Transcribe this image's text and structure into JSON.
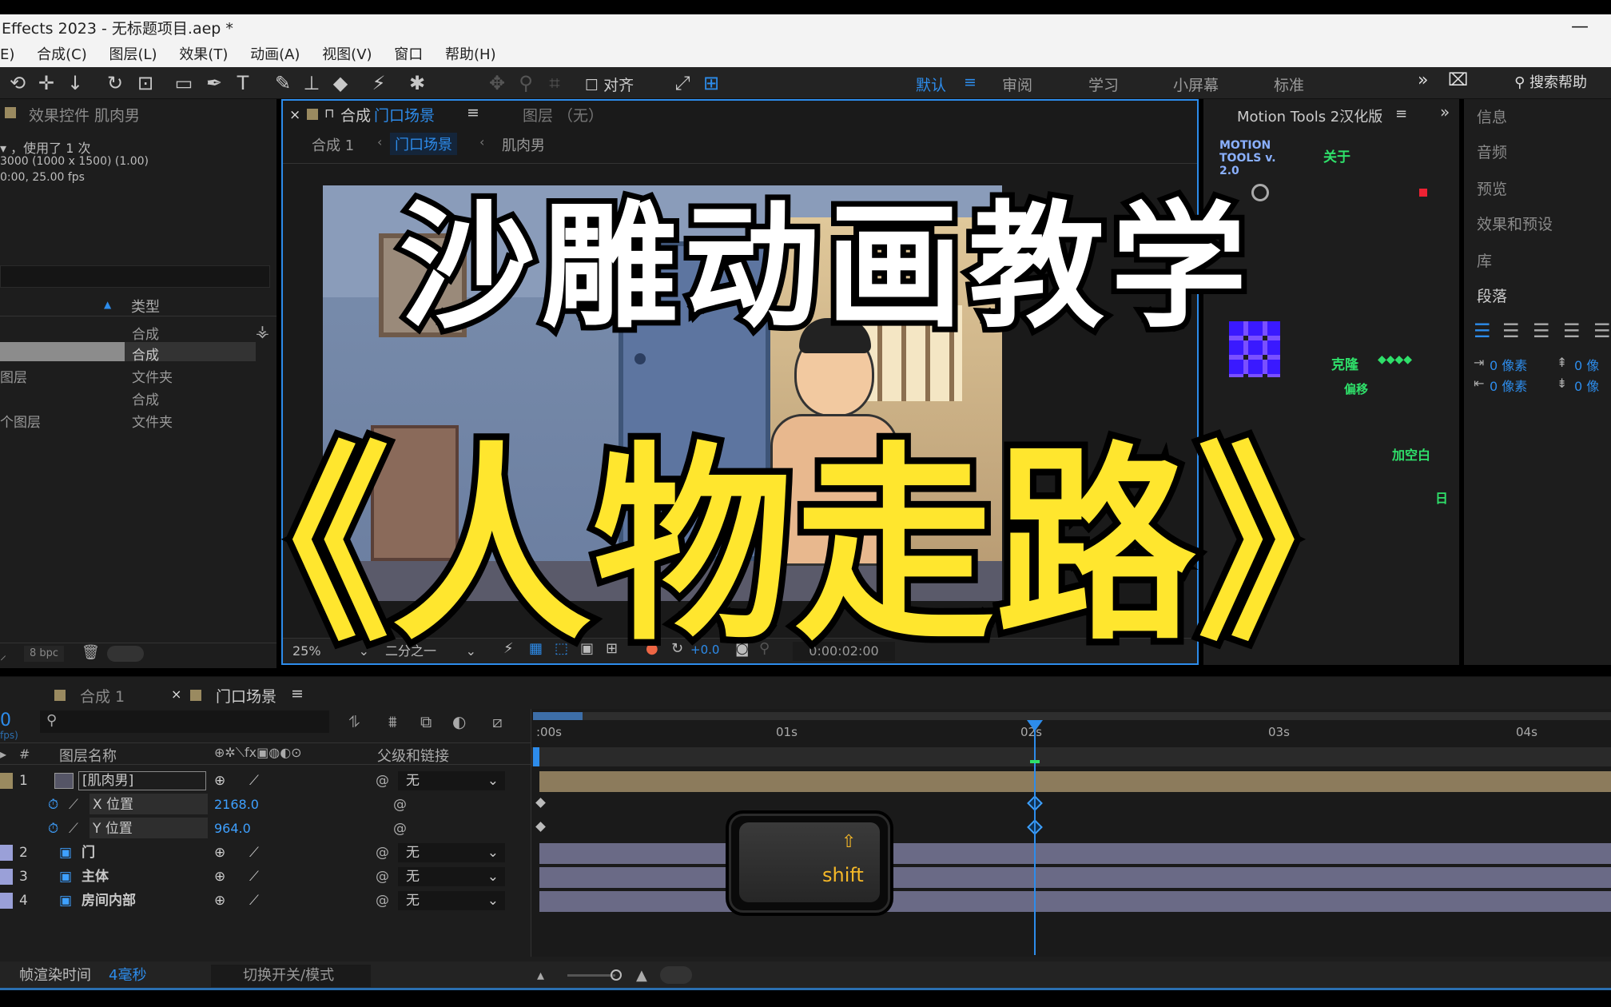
{
  "window": {
    "title": "Effects 2023 - 无标题项目.aep *",
    "minimize": "—"
  },
  "menu": [
    "E)",
    "合成(C)",
    "图层(L)",
    "效果(T)",
    "动画(A)",
    "视图(V)",
    "窗口",
    "帮助(H)"
  ],
  "toolbar": {
    "snap_label": "对齐",
    "workspaces": [
      "默认",
      "审阅",
      "学习",
      "小屏幕",
      "标准"
    ],
    "active_workspace": "默认",
    "more": "»",
    "search_help": "搜索帮助"
  },
  "project_panel": {
    "title": "效果控件 肌肉男",
    "info_line1": "▾ ，使用了 1 次",
    "info_line2": "3000 (1000 x 1500) (1.00)",
    "info_line3": "0:00, 25.00 fps",
    "type_header": "类型",
    "items": [
      {
        "name": "",
        "type": "合成"
      },
      {
        "name": "",
        "type": "合成"
      },
      {
        "name": "图层",
        "type": "文件夹"
      },
      {
        "name": "",
        "type": "合成"
      },
      {
        "name": "个图层",
        "type": "文件夹"
      }
    ],
    "bpc": "8 bpc"
  },
  "viewer": {
    "tab_close": "×",
    "tab_lock": "🔒",
    "tab_prefix": "合成",
    "tab_name": "门口场景",
    "layer_tab": "图层  （无）",
    "breadcrumbs": [
      "合成 1",
      "门口场景",
      "肌肉男"
    ],
    "zoom": "25%",
    "resolution": "二分之一",
    "exposure": "+0.0",
    "timecode": "0:00:02:00"
  },
  "overlay": {
    "title_line1": "沙雕动画教学",
    "title_line2": "《人物走路》"
  },
  "motion_tools": {
    "title": "Motion Tools 2汉化版",
    "logo": "MOTION TOOLS v. 2.0",
    "about": "关于",
    "clone": "克隆",
    "offset": "偏移",
    "add_null": "加空白",
    "ri": "日"
  },
  "right_panels": {
    "items": [
      "信息",
      "音频",
      "预览",
      "效果和预设",
      "库",
      "段落"
    ],
    "indent_values": [
      "0 像素",
      "0 像",
      "0 像素",
      "0 像"
    ]
  },
  "timeline": {
    "tabs": [
      "合成 1",
      "门口场景"
    ],
    "active_tab": "门口场景",
    "time_display": "0",
    "fps_label": "fps)",
    "search_placeholder": "",
    "col_num": "#",
    "col_name": "图层名称",
    "col_parent": "父级和链接",
    "ruler": [
      ":00s",
      "01s",
      "02s",
      "03s",
      "04s"
    ],
    "layers": [
      {
        "num": "1",
        "name": "[肌肉男]",
        "parent": "无"
      },
      {
        "num": "2",
        "name": "门",
        "parent": "无"
      },
      {
        "num": "3",
        "name": "主体",
        "parent": "无"
      },
      {
        "num": "4",
        "name": "房间内部",
        "parent": "无"
      }
    ],
    "props": [
      {
        "name": "X 位置",
        "value": "2168.0"
      },
      {
        "name": "Y 位置",
        "value": "964.0"
      }
    ],
    "shift_key": "shift",
    "render_time_label": "帧渲染时间",
    "render_time_value": "4毫秒",
    "toggle_modes": "切换开关/模式"
  },
  "colors": {
    "accent": "#2d8ceb",
    "title_yellow": "#ffe62e",
    "layer_tan": "#8c7b5c",
    "layer_lilac": "#6a6a86"
  }
}
